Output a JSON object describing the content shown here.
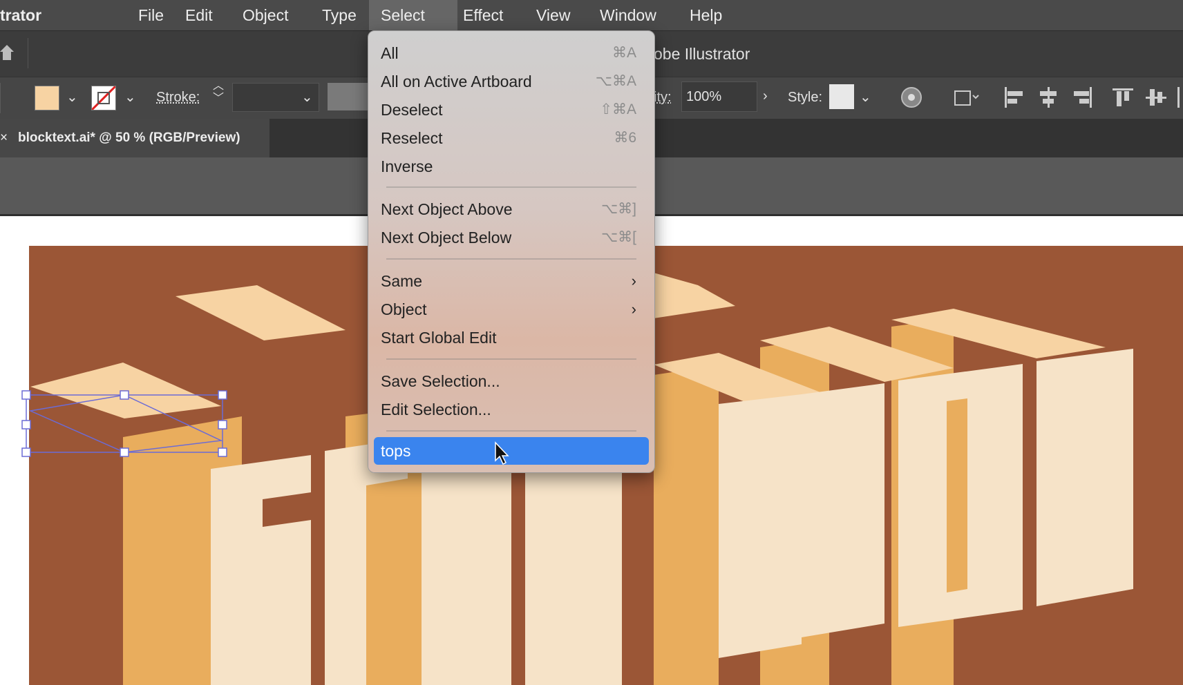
{
  "app": {
    "name": "trator",
    "window_title_fragment": "obe Illustrator"
  },
  "menubar": {
    "items": [
      {
        "label": "File"
      },
      {
        "label": "Edit"
      },
      {
        "label": "Object"
      },
      {
        "label": "Type"
      },
      {
        "label": "Select",
        "active": true
      },
      {
        "label": "Effect"
      },
      {
        "label": "View"
      },
      {
        "label": "Window"
      },
      {
        "label": "Help"
      }
    ]
  },
  "control_bar": {
    "fill_color": "#f7d3a3",
    "stroke_label": "Stroke:",
    "opacity_label": "ity:",
    "opacity_value": "100%",
    "style_label": "Style:"
  },
  "document_tab": {
    "close": "×",
    "title": "blocktext.ai* @ 50 % (RGB/Preview)"
  },
  "select_menu": {
    "items": [
      {
        "label": "All",
        "shortcut": "⌘A"
      },
      {
        "label": "All on Active Artboard",
        "shortcut": "⌥⌘A"
      },
      {
        "label": "Deselect",
        "shortcut": "⇧⌘A"
      },
      {
        "label": "Reselect",
        "shortcut": "⌘6"
      },
      {
        "label": "Inverse",
        "shortcut": ""
      },
      {
        "label": "Next Object Above",
        "shortcut": "⌥⌘]"
      },
      {
        "label": "Next Object Below",
        "shortcut": "⌥⌘["
      },
      {
        "label": "Same",
        "shortcut": "",
        "submenu": true
      },
      {
        "label": "Object",
        "shortcut": "",
        "submenu": true
      },
      {
        "label": "Start Global Edit",
        "shortcut": ""
      },
      {
        "label": "Save Selection...",
        "shortcut": ""
      },
      {
        "label": "Edit Selection...",
        "shortcut": ""
      },
      {
        "label": "tops",
        "shortcut": "",
        "highlighted": true
      }
    ]
  },
  "artwork": {
    "text": "SELECTION",
    "background_color": "#9b5636",
    "face_color": "#f6e3c8",
    "side_color": "#e9ad5d",
    "top_color": "#f7d3a3"
  }
}
